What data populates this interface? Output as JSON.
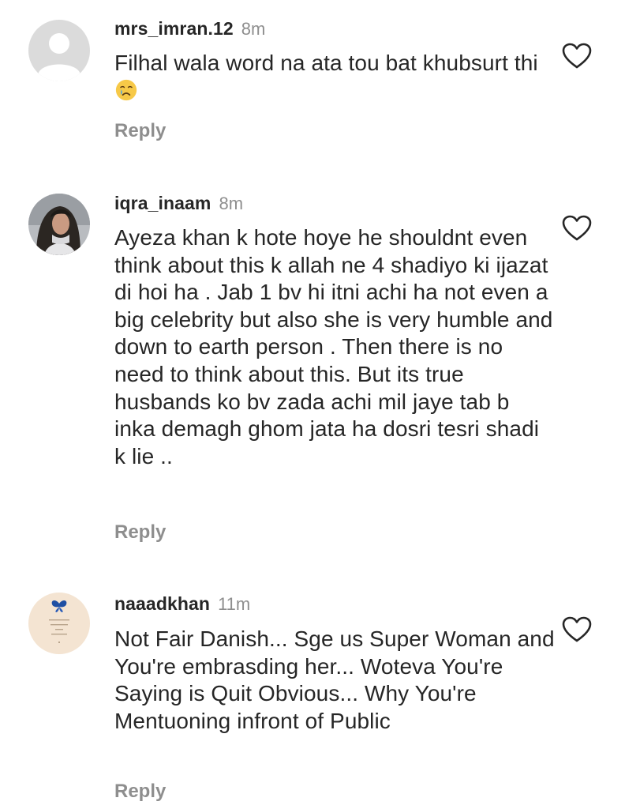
{
  "comments": [
    {
      "username": "mrs_imran.12",
      "time": "8m",
      "text": "Filhal wala word na ata tou bat khubsurt thi",
      "emoji": "crying-face",
      "reply_label": "Reply",
      "avatar": "default-profile-avatar"
    },
    {
      "username": "iqra_inaam",
      "time": "8m",
      "text": "Ayeza khan k hote hoye he shouldnt even think about this k allah ne 4 shadiyo ki ijazat di hoi ha . Jab 1 bv hi itni achi ha not even a big celebrity but also she is very humble and down to earth person . Then there is no need to think about this.  But its true husbands ko bv zada achi mil jaye tab b inka demagh ghom jata ha dosri tesri shadi k lie ..",
      "reply_label": "Reply",
      "avatar": "profile-photo"
    },
    {
      "username": "naaadkhan",
      "time": "11m",
      "text": "Not Fair Danish... Sge us Super Woman and You're embrasding her... Woteva You're Saying is Quit Obvious... Why You're Mentuoning infront of Public",
      "reply_label": "Reply",
      "avatar": "butterfly-avatar"
    }
  ],
  "icons": {
    "like": "heart-outline-icon"
  },
  "colors": {
    "text": "#262626",
    "secondary": "#8e8e8e",
    "background": "#ffffff"
  }
}
